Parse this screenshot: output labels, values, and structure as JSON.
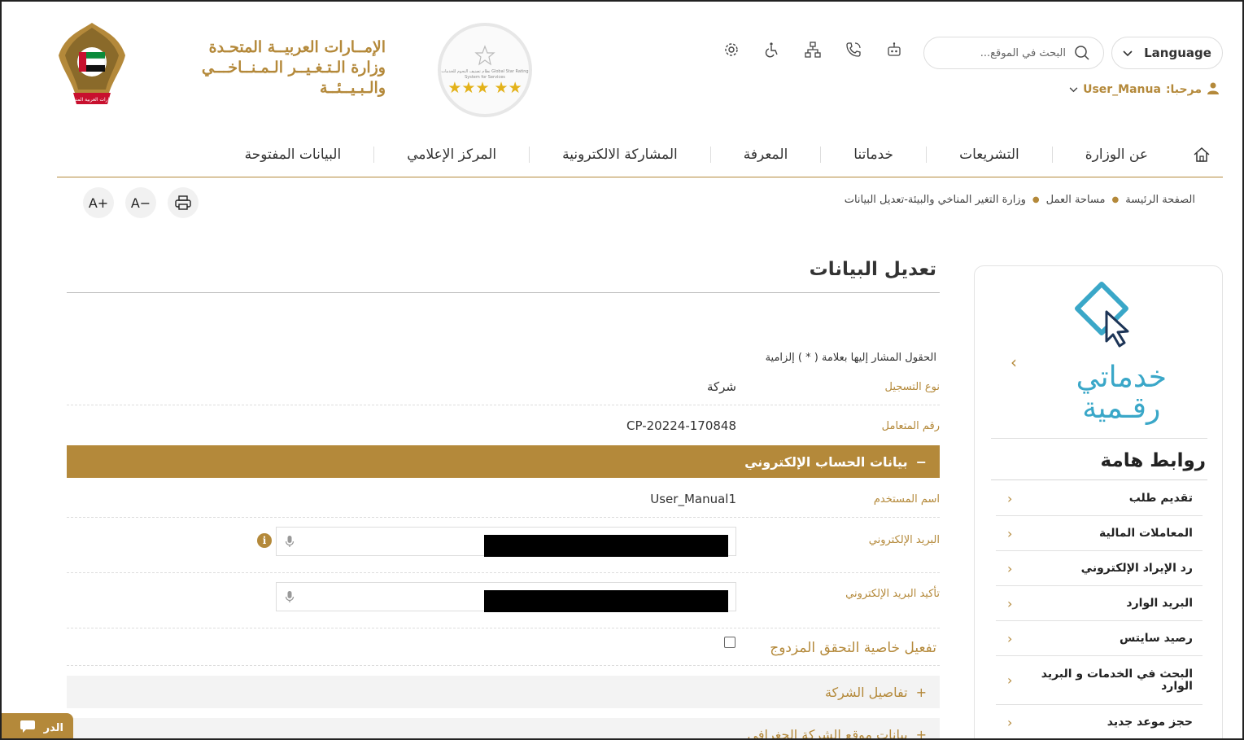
{
  "header": {
    "ministry_line1": "الإمــارات العربيــة المتحـدة",
    "ministry_line2": "وزارة الـتـغـيــر الـمـنــاخـــي",
    "ministry_line3": "والـبـيــئــة",
    "emblem_label": "الإمارات العربية المتحدة",
    "badge_text": "نظام تصنيف النجوم للخدمات Global Star Rating System for Services",
    "badge_stars": "★★★ ★★",
    "search_placeholder": "البحث في الموقع...",
    "language_label": "Language",
    "welcome_label": "مرحبا:",
    "username": "User_Manua",
    "icons": [
      "settings-icon",
      "accessibility-icon",
      "sitemap-icon",
      "phone-icon",
      "robot-icon"
    ]
  },
  "nav": {
    "items": [
      "عن الوزارة",
      "التشريعات",
      "خدماتنا",
      "المعرفة",
      "المشاركة الالكترونية",
      "المركز الإعلامي",
      "البيانات المفتوحة"
    ]
  },
  "breadcrumb": [
    "الصفحة الرئيسة",
    "مساحة العمل",
    "وزارة التغير المناخي والبيئة-تعديل البيانات"
  ],
  "tools": {
    "font_increase": "A+",
    "font_decrease": "A−"
  },
  "sidebar": {
    "promo_line1": "خدماتي",
    "promo_line2": "رقـمية",
    "links_title": "روابط هامة",
    "links": [
      "تقديم طلب",
      "المعاملات المالية",
      "رد الإيراد الإلكتروني",
      "البريد الوارد",
      "رصيد سايتس",
      "البحث في الخدمات و البريد الوارد",
      "حجز موعد جديد"
    ]
  },
  "form": {
    "title": "تعديل البيانات",
    "required_note": "الحقول المشار إليها بعلامة ( * ) إلزامية",
    "registration_type_label": "نوع التسجيل",
    "registration_type_value": "شركة",
    "customer_number_label": "رقم المتعامل",
    "customer_number_value": "CP-20224-170848",
    "account_section": "بيانات الحساب الإلكتروني",
    "username_label": "اسم المستخدم",
    "username_value": "User_Manual1",
    "email_label": "البريد الإلكتروني",
    "confirm_email_label": "تأكيد البريد الإلكتروني",
    "twofa_label": "تفعيل خاصية التحقق المزدوج",
    "twofa_checked": false,
    "company_details_section": "تفاصيل الشركة",
    "company_location_section": "بيانات موقع الشركة الجغرافي",
    "email_info_icon": "i"
  },
  "chat": {
    "label": "الدر"
  },
  "colors": {
    "accent": "#b4893a",
    "promo": "#3aa7c8"
  }
}
